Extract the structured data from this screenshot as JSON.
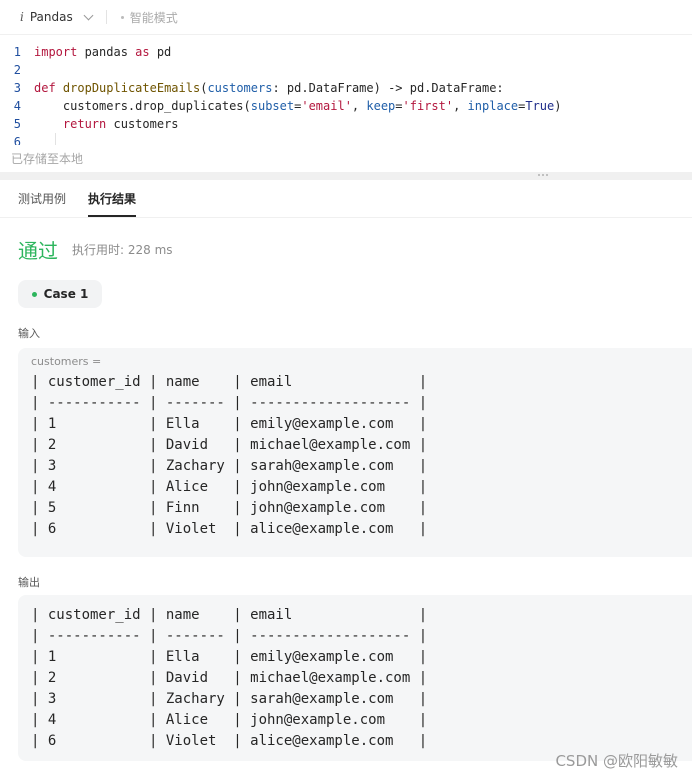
{
  "toolbar": {
    "lang_prefix": "i",
    "language": "Pandas",
    "mode": "智能模式"
  },
  "editor": {
    "line_numbers": [
      "1",
      "2",
      "3",
      "4",
      "5",
      "6"
    ],
    "lines": [
      [
        {
          "t": "import",
          "c": "kw"
        },
        {
          "t": " pandas ",
          "c": "plain"
        },
        {
          "t": "as",
          "c": "kw"
        },
        {
          "t": " pd",
          "c": "plain"
        }
      ],
      [],
      [
        {
          "t": "def",
          "c": "kw"
        },
        {
          "t": " ",
          "c": "plain"
        },
        {
          "t": "dropDuplicateEmails",
          "c": "fn"
        },
        {
          "t": "(",
          "c": "plain"
        },
        {
          "t": "customers",
          "c": "par"
        },
        {
          "t": ": pd.DataFrame) -> pd.DataFrame:",
          "c": "plain"
        }
      ],
      [
        {
          "t": "    customers.drop_duplicates(",
          "c": "plain"
        },
        {
          "t": "subset",
          "c": "par"
        },
        {
          "t": "=",
          "c": "plain"
        },
        {
          "t": "'email'",
          "c": "str"
        },
        {
          "t": ", ",
          "c": "plain"
        },
        {
          "t": "keep",
          "c": "par"
        },
        {
          "t": "=",
          "c": "plain"
        },
        {
          "t": "'first'",
          "c": "str"
        },
        {
          "t": ", ",
          "c": "plain"
        },
        {
          "t": "inplace",
          "c": "par"
        },
        {
          "t": "=",
          "c": "plain"
        },
        {
          "t": "True",
          "c": "ty"
        },
        {
          "t": ")",
          "c": "plain"
        }
      ],
      [
        {
          "t": "    ",
          "c": "plain"
        },
        {
          "t": "return",
          "c": "kw"
        },
        {
          "t": " customers",
          "c": "plain"
        }
      ],
      []
    ]
  },
  "status": {
    "saved": "已存储至本地"
  },
  "tabs": [
    {
      "label": "测试用例",
      "active": false
    },
    {
      "label": "执行结果",
      "active": true
    }
  ],
  "result": {
    "status": "通过",
    "runtime": "执行用时: 228 ms",
    "case_label": "Case 1"
  },
  "input": {
    "section_label": "输入",
    "variable": "customers =",
    "table_lines": [
      "| customer_id | name    | email               |",
      "| ----------- | ------- | ------------------- |",
      "| 1           | Ella    | emily@example.com   |",
      "| 2           | David   | michael@example.com |",
      "| 3           | Zachary | sarah@example.com   |",
      "| 4           | Alice   | john@example.com    |",
      "| 5           | Finn    | john@example.com    |",
      "| 6           | Violet  | alice@example.com   |"
    ]
  },
  "output": {
    "section_label": "输出",
    "table_lines": [
      "| customer_id | name    | email               |",
      "| ----------- | ------- | ------------------- |",
      "| 1           | Ella    | emily@example.com   |",
      "| 2           | David   | michael@example.com |",
      "| 3           | Zachary | sarah@example.com   |",
      "| 4           | Alice   | john@example.com    |",
      "| 6           | Violet  | alice@example.com   |"
    ]
  },
  "watermark": "CSDN @欧阳敏敏",
  "colors": {
    "pass": "#2db55d",
    "keyword": "#b3173e",
    "function": "#6f5400",
    "param": "#1f5ea8"
  }
}
